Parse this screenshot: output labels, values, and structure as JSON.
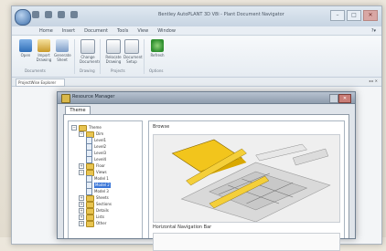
{
  "window": {
    "title": "Bentley AutoPLANT 3D V8i - Plant Document Navigator",
    "quick_access": [
      "qa-new",
      "qa-open",
      "qa-save",
      "qa-undo"
    ]
  },
  "menu": [
    "Home",
    "Insert",
    "Document",
    "Tools",
    "View",
    "Window"
  ],
  "ribbon": {
    "buttons": [
      {
        "label": "Open",
        "icon": "open-icon"
      },
      {
        "label": "Import Drawing",
        "icon": "import-icon"
      },
      {
        "label": "Generate Sheet",
        "icon": "generate-icon"
      },
      {
        "label": "Change Documents",
        "icon": "change-icon"
      },
      {
        "label": "Relocate Drawing",
        "icon": "relocate-icon"
      },
      {
        "label": "Document Setup",
        "icon": "setup-icon"
      },
      {
        "label": "Refresh",
        "icon": "refresh-icon"
      }
    ],
    "groups": [
      "Documents",
      "Drawing",
      "Projects",
      "Options"
    ]
  },
  "doc_tab": {
    "label": "ProjectWise Explorer"
  },
  "dialog": {
    "title": "Resource Manager",
    "tab": "Theme",
    "tree": [
      {
        "label": "Theme",
        "type": "folder",
        "level": 0,
        "expanded": true
      },
      {
        "label": "Dim",
        "type": "folder",
        "level": 1,
        "expanded": true
      },
      {
        "label": "Level1",
        "type": "file",
        "level": 2
      },
      {
        "label": "Level2",
        "type": "file",
        "level": 2
      },
      {
        "label": "Level3",
        "type": "file",
        "level": 2
      },
      {
        "label": "Level4",
        "type": "file",
        "level": 2
      },
      {
        "label": "Floor",
        "type": "folder",
        "level": 1
      },
      {
        "label": "Views",
        "type": "folder",
        "level": 1,
        "expanded": true
      },
      {
        "label": "Model 1",
        "type": "file",
        "level": 2
      },
      {
        "label": "Model 2",
        "type": "file",
        "level": 2,
        "selected": true
      },
      {
        "label": "Model 3",
        "type": "file",
        "level": 2
      },
      {
        "label": "Sheets",
        "type": "folder",
        "level": 1
      },
      {
        "label": "Sections",
        "type": "folder",
        "level": 1
      },
      {
        "label": "Details",
        "type": "folder",
        "level": 1
      },
      {
        "label": "Lists",
        "type": "folder",
        "level": 1
      },
      {
        "label": "Other",
        "type": "folder",
        "level": 1
      }
    ],
    "preview_label": "Browse",
    "hnav_label": "Horizontal Navigation Bar"
  }
}
